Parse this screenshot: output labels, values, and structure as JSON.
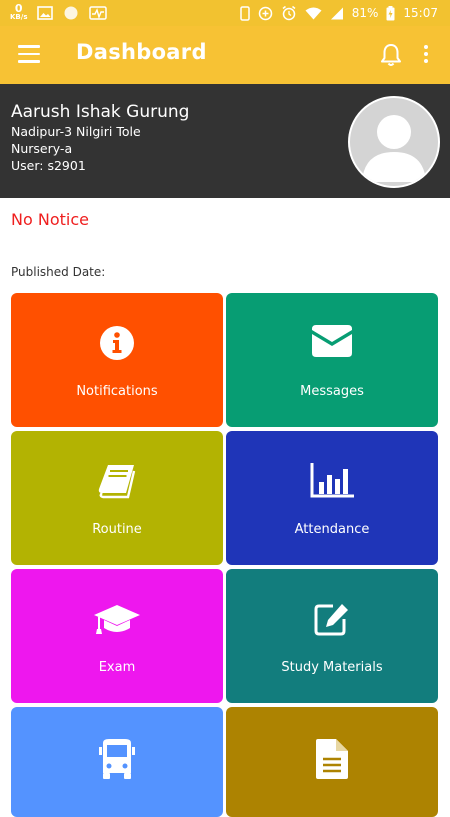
{
  "status_bar": {
    "net_speed": "0",
    "net_unit": "KB/s",
    "battery": "81%",
    "time": "15:07"
  },
  "app_bar": {
    "title": "Dashboard",
    "menu_icon": "hamburger-menu-icon",
    "notification_icon": "bell-icon",
    "more_icon": "more-vert-icon"
  },
  "profile": {
    "name": "Aarush Ishak Gurung",
    "address": "Nadipur-3 Nilgiri Tole",
    "class": "Nursery-a",
    "user": "User: s2901"
  },
  "notice": {
    "text": "No Notice",
    "published_label": "Published Date:"
  },
  "colors": {
    "app_bar": "#f7c234",
    "profile_bg": "#333333",
    "notice": "#ef1f1f"
  },
  "tiles": [
    {
      "label": "Notifications",
      "icon": "info-circle-icon",
      "color": "#ff5000"
    },
    {
      "label": "Messages",
      "icon": "envelope-icon",
      "color": "#079d73"
    },
    {
      "label": "Routine",
      "icon": "book-icon",
      "color": "#b3b302"
    },
    {
      "label": "Attendance",
      "icon": "bar-chart-icon",
      "color": "#1f35b8"
    },
    {
      "label": "Exam",
      "icon": "graduation-cap-icon",
      "color": "#ee17ee"
    },
    {
      "label": "Study Materials",
      "icon": "edit-icon",
      "color": "#127d7d"
    },
    {
      "label": "",
      "icon": "bus-icon",
      "color": "#5493ff"
    },
    {
      "label": "",
      "icon": "document-icon",
      "color": "#ad8301"
    }
  ]
}
